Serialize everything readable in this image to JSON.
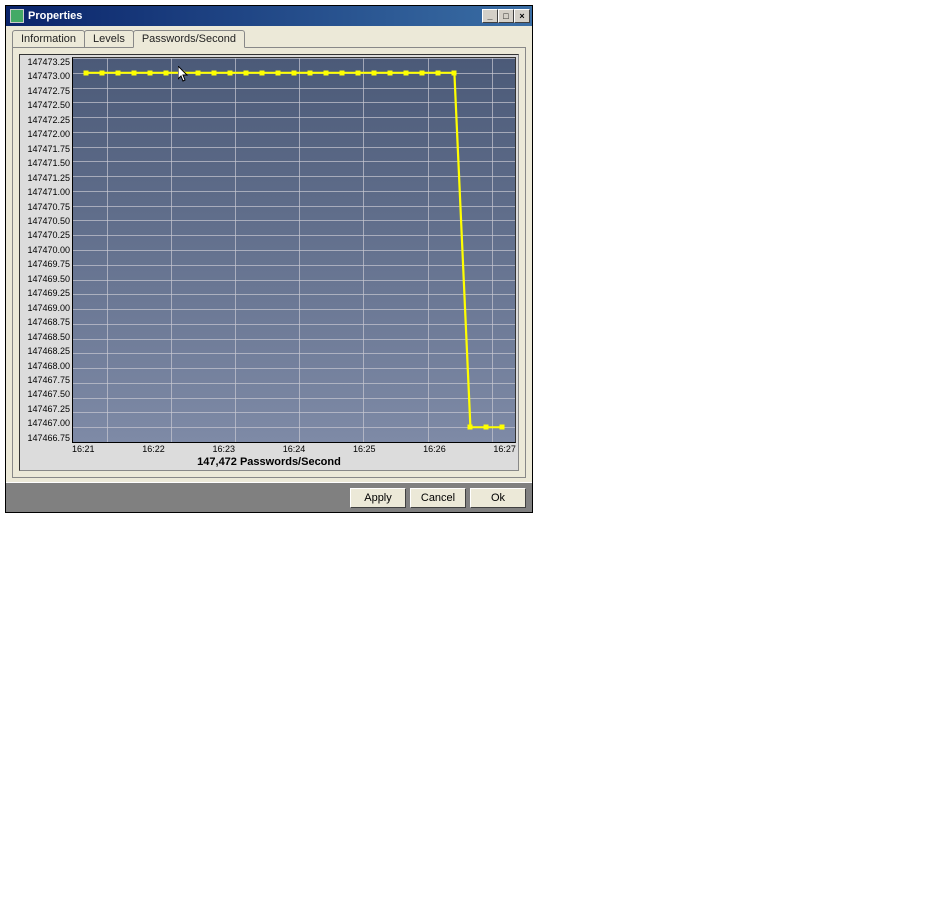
{
  "dialog": {
    "title": "Properties",
    "buttons": {
      "minimize": "_",
      "maximize": "□",
      "close": "×"
    }
  },
  "tabs": [
    {
      "label": "Information",
      "active": false
    },
    {
      "label": "Levels",
      "active": false
    },
    {
      "label": "Passwords/Second",
      "active": true
    }
  ],
  "footer": {
    "apply": "Apply",
    "cancel": "Cancel",
    "ok": "Ok"
  },
  "chart_data": {
    "type": "line",
    "title": "147,472  Passwords/Second",
    "xlabel": "",
    "ylabel": "",
    "ylim": [
      147466.75,
      147473.25
    ],
    "yticks": [
      147473.25,
      147473.0,
      147472.75,
      147472.5,
      147472.25,
      147472.0,
      147471.75,
      147471.5,
      147471.25,
      147471.0,
      147470.75,
      147470.5,
      147470.25,
      147470.0,
      147469.75,
      147469.5,
      147469.25,
      147469.0,
      147468.75,
      147468.5,
      147468.25,
      147468.0,
      147467.75,
      147467.5,
      147467.25,
      147467.0,
      147466.75
    ],
    "xticks": [
      "16:21",
      "16:22",
      "16:23",
      "16:24",
      "16:25",
      "16:26",
      "16:27"
    ],
    "series": [
      {
        "name": "Passwords/Second",
        "color": "#ffff00",
        "points": [
          {
            "x": "16:20:40",
            "y": 147473.0
          },
          {
            "x": "16:20:55",
            "y": 147473.0
          },
          {
            "x": "16:21:10",
            "y": 147473.0
          },
          {
            "x": "16:21:25",
            "y": 147473.0
          },
          {
            "x": "16:21:40",
            "y": 147473.0
          },
          {
            "x": "16:21:55",
            "y": 147473.0
          },
          {
            "x": "16:22:10",
            "y": 147473.0
          },
          {
            "x": "16:22:25",
            "y": 147473.0
          },
          {
            "x": "16:22:40",
            "y": 147473.0
          },
          {
            "x": "16:22:55",
            "y": 147473.0
          },
          {
            "x": "16:23:10",
            "y": 147473.0
          },
          {
            "x": "16:23:25",
            "y": 147473.0
          },
          {
            "x": "16:23:40",
            "y": 147473.0
          },
          {
            "x": "16:23:55",
            "y": 147473.0
          },
          {
            "x": "16:24:10",
            "y": 147473.0
          },
          {
            "x": "16:24:25",
            "y": 147473.0
          },
          {
            "x": "16:24:40",
            "y": 147473.0
          },
          {
            "x": "16:24:55",
            "y": 147473.0
          },
          {
            "x": "16:25:10",
            "y": 147473.0
          },
          {
            "x": "16:25:25",
            "y": 147473.0
          },
          {
            "x": "16:25:40",
            "y": 147473.0
          },
          {
            "x": "16:25:55",
            "y": 147473.0
          },
          {
            "x": "16:26:10",
            "y": 147473.0
          },
          {
            "x": "16:26:25",
            "y": 147473.0
          },
          {
            "x": "16:26:40",
            "y": 147467.0
          },
          {
            "x": "16:26:55",
            "y": 147467.0
          },
          {
            "x": "16:27:10",
            "y": 147467.0
          }
        ]
      }
    ]
  }
}
